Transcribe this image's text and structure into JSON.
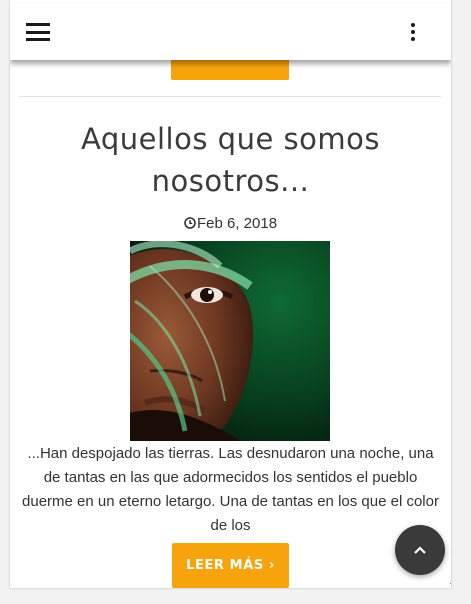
{
  "post": {
    "title": "Aquellos que somos nosotros...",
    "date": "Feb 6, 2018",
    "excerpt": "...Han despojado las tierras. Las desnudaron una noche, una de tantas en las que adormecidos los sentidos el pueblo duerme en un eterno letargo. Una de tantas en los que el color de los",
    "read_more_label": "LEER MÁS ›"
  },
  "colors": {
    "accent": "#f7a30b",
    "fab": "#3a3a3a",
    "title": "#3b3b3b"
  },
  "icons": {
    "menu": "hamburger-menu-icon",
    "more": "vertical-dots-icon",
    "date": "clock-icon",
    "scroll_top": "chevron-up-icon"
  }
}
